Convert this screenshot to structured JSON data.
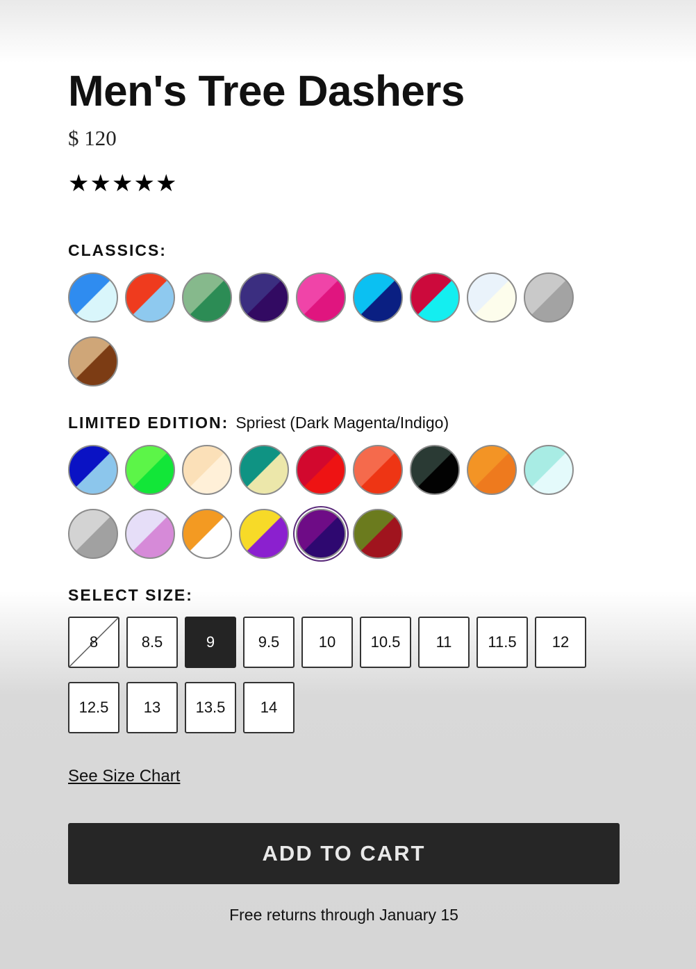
{
  "product": {
    "title": "Men's Tree Dashers",
    "price": "$ 120",
    "rating": {
      "value": 5,
      "max": 5,
      "star_glyph": "★"
    }
  },
  "classics": {
    "label": "CLASSICS:",
    "swatches": [
      {
        "top": "#2f8cf0",
        "bottom": "#d9f6fb"
      },
      {
        "top": "#ef3b1e",
        "bottom": "#8ec9ef"
      },
      {
        "top": "#86b98c",
        "bottom": "#2c8c55"
      },
      {
        "top": "#3b2e80",
        "bottom": "#320a62"
      },
      {
        "top": "#f044a8",
        "bottom": "#e0157f"
      },
      {
        "top": "#0bc0f2",
        "bottom": "#0a1f82"
      },
      {
        "top": "#cc0a3c",
        "bottom": "#14eef0"
      },
      {
        "top": "#eaf3fb",
        "bottom": "#fdfdec"
      },
      {
        "top": "#c9c9c9",
        "bottom": "#a3a3a3"
      },
      {
        "top": "#cfa678",
        "bottom": "#7c3c14"
      }
    ]
  },
  "limited": {
    "label": "LIMITED EDITION:",
    "selected_name": "Spriest (Dark Magenta/Indigo)",
    "selected_index": 13,
    "swatches": [
      {
        "top": "#0a12c4",
        "bottom": "#8cc6ec"
      },
      {
        "top": "#5cf548",
        "bottom": "#12e638"
      },
      {
        "top": "#fbe0b8",
        "bottom": "#fff0d8"
      },
      {
        "top": "#0f9383",
        "bottom": "#ece7aa"
      },
      {
        "top": "#d2082e",
        "bottom": "#ee1313"
      },
      {
        "top": "#f56a4c",
        "bottom": "#ee3514"
      },
      {
        "top": "#2a3a34",
        "bottom": "#020202"
      },
      {
        "top": "#f39425",
        "bottom": "#ee7a1e"
      },
      {
        "top": "#a8ece4",
        "bottom": "#e4fafb"
      },
      {
        "top": "#d3d3d3",
        "bottom": "#a1a1a1"
      },
      {
        "top": "#e6def8",
        "bottom": "#d68ad8"
      },
      {
        "top": "#f39a22",
        "bottom": "#ffffff"
      },
      {
        "top": "#f7da28",
        "bottom": "#8b20cf"
      },
      {
        "top": "#6e0c86",
        "bottom": "#2e0870"
      },
      {
        "top": "#6b7b1e",
        "bottom": "#a0141e"
      }
    ]
  },
  "sizes": {
    "label": "SELECT SIZE:",
    "selected": "9",
    "unavailable": [
      "8"
    ],
    "options": [
      "8",
      "8.5",
      "9",
      "9.5",
      "10",
      "10.5",
      "11",
      "11.5",
      "12",
      "12.5",
      "13",
      "13.5",
      "14"
    ]
  },
  "size_chart_link": "See Size Chart",
  "cart": {
    "button_label": "ADD TO CART"
  },
  "returns_text": "Free returns through January 15",
  "colors": {
    "button_bg": "#262626",
    "selected_size_bg": "#242424",
    "selected_swatch_ring": "#5a2a7a"
  }
}
